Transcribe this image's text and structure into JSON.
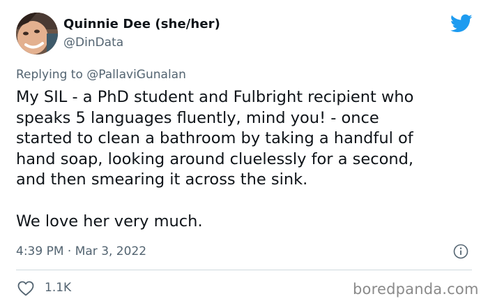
{
  "tweet": {
    "author_name": "Quinnie Dee (she/her)",
    "author_handle": "@DinData",
    "reply_prefix": "Replying to ",
    "reply_mention": "@PallaviGunalan",
    "body_lines": [
      "My SIL - a PhD student and Fulbright recipient who",
      "speaks 5 languages fluently, mind you! - once",
      "started to clean a bathroom by taking a handful of",
      "hand soap, looking around cluelessly for a second,",
      "and then smearing it across the sink."
    ],
    "body_closing": "We love her very much.",
    "timestamp": "4:39 PM · Mar 3, 2022",
    "like_count": "1.1K"
  },
  "watermark": "boredpanda.com",
  "icons": {
    "brand": "twitter-bird-icon",
    "info": "info-icon",
    "like": "heart-icon"
  },
  "colors": {
    "twitter_blue": "#1d9bf0",
    "secondary_text": "#536471",
    "primary_text": "#0f1419",
    "divider": "#cfd9de",
    "watermark": "#8a8a8a"
  }
}
